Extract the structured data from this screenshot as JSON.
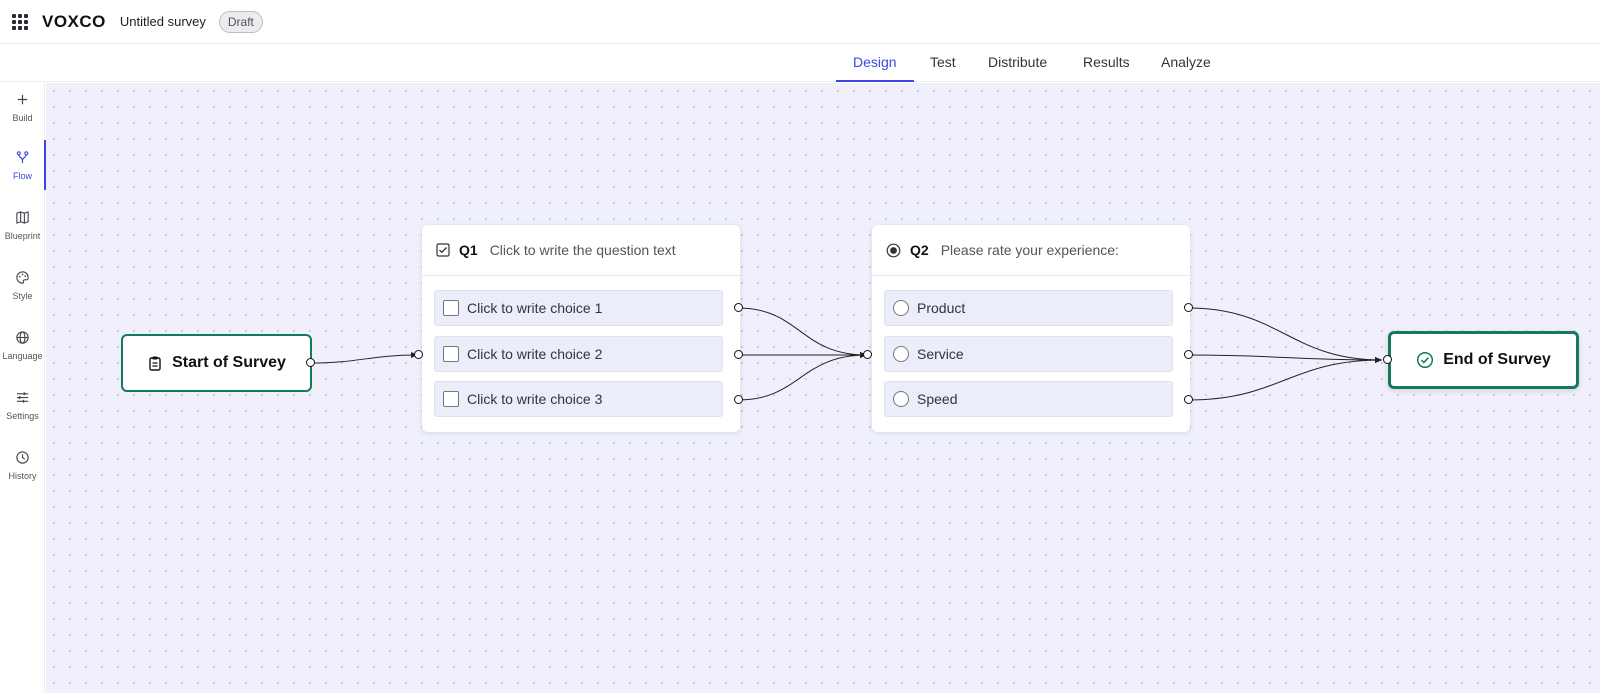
{
  "app": {
    "logo": "VOXCO",
    "survey_title": "Untitled survey",
    "status_badge": "Draft"
  },
  "tabs": [
    {
      "label": "Design",
      "active": true
    },
    {
      "label": "Test"
    },
    {
      "label": "Distribute"
    },
    {
      "label": "Results"
    },
    {
      "label": "Analyze"
    }
  ],
  "sidebar": {
    "items": [
      {
        "label": "Build",
        "icon": "plus-icon"
      },
      {
        "label": "Flow",
        "icon": "flow-icon",
        "active": true
      },
      {
        "label": "Blueprint",
        "icon": "map-icon"
      },
      {
        "label": "Style",
        "icon": "palette-icon"
      },
      {
        "label": "Language",
        "icon": "globe-icon"
      },
      {
        "label": "Settings",
        "icon": "sliders-icon"
      },
      {
        "label": "History",
        "icon": "clock-icon"
      }
    ]
  },
  "flow": {
    "start": {
      "label": "Start of Survey",
      "icon": "clipboard-icon"
    },
    "end": {
      "label": "End of Survey",
      "icon": "check-circle-icon"
    },
    "q1": {
      "number": "Q1",
      "type": "checkbox",
      "text": "Click to write the question text",
      "choices": [
        "Click to write choice 1",
        "Click to write choice 2",
        "Click to write choice 3"
      ]
    },
    "q2": {
      "number": "Q2",
      "type": "radio",
      "text": "Please rate your experience:",
      "choices": [
        "Product",
        "Service",
        "Speed"
      ]
    }
  },
  "colors": {
    "accent": "#3b49df",
    "terminal_border": "#137a5c",
    "canvas_bg": "#eff0fc",
    "choice_bg": "#ebedfb"
  }
}
